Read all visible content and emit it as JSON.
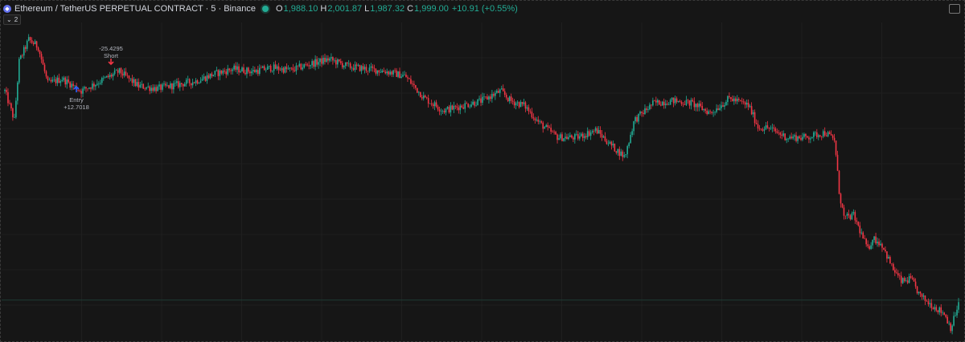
{
  "header": {
    "title": "Ethereum / TetherUS PERPETUAL CONTRACT · 5 · Binance",
    "o_label": "O",
    "o_value": "1,988.10",
    "h_label": "H",
    "h_value": "2,001.87",
    "l_label": "L",
    "l_value": "1,987.32",
    "c_label": "C",
    "c_value": "1,999.00",
    "change": "+10.91 (+0.55%)"
  },
  "collapse_label": "2",
  "annotations": {
    "short_value": "-25.4295",
    "short_label": "Short",
    "entry_label": "Entry",
    "entry_value": "+12.7018"
  },
  "colors": {
    "up": "#22ab94",
    "down": "#f23645",
    "entry": "#2962ff",
    "short": "#f23645",
    "background": "#161616"
  },
  "chart_data": {
    "type": "candlestick",
    "series_shape": [
      [
        0.0,
        2004
      ],
      [
        0.01,
        1980
      ],
      [
        0.015,
        2028
      ],
      [
        0.025,
        2046
      ],
      [
        0.035,
        2040
      ],
      [
        0.045,
        2010
      ],
      [
        0.06,
        2014
      ],
      [
        0.08,
        2004
      ],
      [
        0.1,
        2012
      ],
      [
        0.12,
        2020
      ],
      [
        0.14,
        2008
      ],
      [
        0.16,
        2006
      ],
      [
        0.18,
        2009
      ],
      [
        0.2,
        2012
      ],
      [
        0.22,
        2018
      ],
      [
        0.24,
        2022
      ],
      [
        0.26,
        2020
      ],
      [
        0.28,
        2023
      ],
      [
        0.3,
        2021
      ],
      [
        0.32,
        2026
      ],
      [
        0.34,
        2030
      ],
      [
        0.36,
        2024
      ],
      [
        0.38,
        2022
      ],
      [
        0.4,
        2020
      ],
      [
        0.42,
        2016
      ],
      [
        0.44,
        1998
      ],
      [
        0.46,
        1988
      ],
      [
        0.48,
        1992
      ],
      [
        0.5,
        1996
      ],
      [
        0.52,
        2004
      ],
      [
        0.53,
        1996
      ],
      [
        0.545,
        1992
      ],
      [
        0.56,
        1978
      ],
      [
        0.58,
        1966
      ],
      [
        0.6,
        1966
      ],
      [
        0.62,
        1972
      ],
      [
        0.635,
        1960
      ],
      [
        0.65,
        1950
      ],
      [
        0.66,
        1980
      ],
      [
        0.68,
        1994
      ],
      [
        0.7,
        1996
      ],
      [
        0.72,
        1994
      ],
      [
        0.74,
        1986
      ],
      [
        0.76,
        1998
      ],
      [
        0.78,
        1992
      ],
      [
        0.79,
        1974
      ],
      [
        0.8,
        1974
      ],
      [
        0.82,
        1966
      ],
      [
        0.84,
        1966
      ],
      [
        0.86,
        1970
      ],
      [
        0.87,
        1964
      ],
      [
        0.875,
        1920
      ],
      [
        0.88,
        1900
      ],
      [
        0.89,
        1902
      ],
      [
        0.905,
        1874
      ],
      [
        0.91,
        1884
      ],
      [
        0.92,
        1878
      ],
      [
        0.93,
        1860
      ],
      [
        0.94,
        1848
      ],
      [
        0.95,
        1850
      ],
      [
        0.96,
        1836
      ],
      [
        0.97,
        1830
      ],
      [
        0.985,
        1822
      ],
      [
        0.992,
        1810
      ],
      [
        1.0,
        1830
      ]
    ],
    "entry_index_frac": 0.078,
    "short_index_frac": 0.115,
    "price_reference_line": 1833
  }
}
